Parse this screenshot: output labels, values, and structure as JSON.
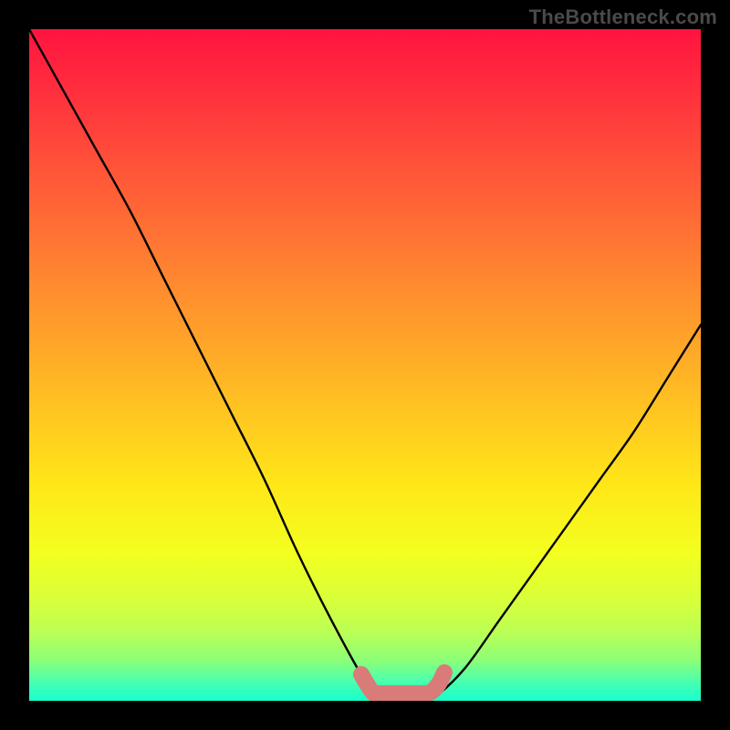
{
  "watermark": "TheBottleneck.com",
  "chart_data": {
    "type": "line",
    "title": "",
    "xlabel": "",
    "ylabel": "",
    "xlim": [
      0,
      100
    ],
    "ylim": [
      0,
      100
    ],
    "grid": false,
    "series": [
      {
        "name": "bottleneck-curve",
        "x": [
          0,
          5,
          10,
          15,
          20,
          25,
          30,
          35,
          40,
          45,
          50,
          53,
          56,
          59,
          61,
          65,
          70,
          75,
          80,
          85,
          90,
          95,
          100
        ],
        "values": [
          100,
          91,
          82,
          73,
          63,
          53,
          43,
          33,
          22,
          12,
          3,
          0,
          0,
          0,
          1,
          5,
          12,
          19,
          26,
          33,
          40,
          48,
          56
        ]
      }
    ],
    "annotations": [
      {
        "name": "optimum-range",
        "x_start": 50,
        "x_end": 61,
        "y": 0
      }
    ],
    "gradient_background": {
      "top_color": "#ff133f",
      "bottom_color": "#17ffcd"
    }
  }
}
